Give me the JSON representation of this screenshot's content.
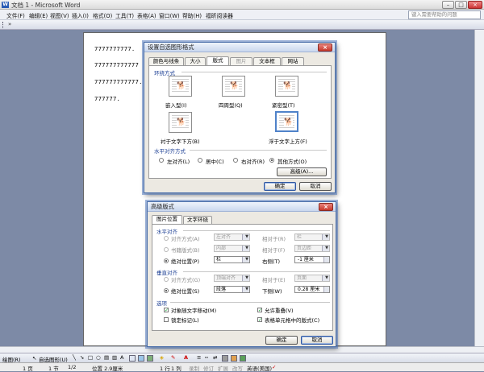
{
  "window": {
    "title": "文档 1 - Microsoft Word"
  },
  "menu": {
    "items": [
      "文件(F)",
      "编辑(E)",
      "视图(V)",
      "插入(I)",
      "格式(O)",
      "工具(T)",
      "表格(A)",
      "窗口(W)",
      "帮助(H)",
      "福昕阅读器"
    ],
    "help_placeholder": "键入需要帮助的问题"
  },
  "document": {
    "lines": [
      "7777777777.",
      "777777777777",
      "777777777777.",
      "777777."
    ]
  },
  "dialog1": {
    "title": "设置自选图形格式",
    "tabs": [
      "颜色与线条",
      "大小",
      "版式",
      "图片",
      "文本框",
      "网站"
    ],
    "section_wrap": "环绕方式",
    "wrap_options": [
      "嵌入型(I)",
      "四周型(Q)",
      "紧密型(T)",
      "衬于文字下方(B)",
      "浮于文字上方(F)"
    ],
    "section_halign": "水平对齐方式",
    "halign_options": [
      "左对齐(L)",
      "居中(C)",
      "右对齐(R)",
      "其他方式(O)"
    ],
    "advanced_label": "高级(A)...",
    "ok_label": "确定",
    "cancel_label": "取消"
  },
  "dialog2": {
    "title": "高级版式",
    "tabs": [
      "图片位置",
      "文字环绕"
    ],
    "section_h": "水平对齐",
    "h_rows": [
      {
        "label": "对齐方式(A)",
        "value": "左对齐",
        "rel_label": "相对于(R)",
        "rel_value": "栏"
      },
      {
        "label": "书籍版式(B)",
        "value": "内部",
        "rel_label": "相对于(F)",
        "rel_value": "页边距"
      },
      {
        "label": "绝对位置(P)",
        "value": "栏",
        "rel_label": "右侧(T)",
        "rel_value": "-1 厘米"
      }
    ],
    "section_v": "垂直对齐",
    "v_rows": [
      {
        "label": "对齐方式(G)",
        "value": "顶端对齐",
        "rel_label": "相对于(E)",
        "rel_value": "页面"
      },
      {
        "label": "绝对位置(S)",
        "value": "段落",
        "rel_label": "下侧(W)",
        "rel_value": "0.28 厘米"
      }
    ],
    "section_opts": "选项",
    "opts": [
      "对象随文字移动(M)",
      "锁定标记(L)",
      "允许重叠(V)",
      "表格单元格中的版式(C)"
    ],
    "ok_label": "确定",
    "cancel_label": "取消"
  },
  "drawbar": {
    "draw_label": "绘图(R)",
    "autoshape_label": "自选图形(U)"
  },
  "status": {
    "page": "1 页",
    "section": "1 节",
    "pages": "1/2",
    "position": "位置 2.9厘米",
    "line": "1 行",
    "col": "1 列",
    "rec": "录制",
    "rev": "修订",
    "ext": "扩展",
    "ovr": "改写",
    "lang": "英语(美国)"
  },
  "colors": {
    "accent": "#4a6ea9",
    "close_red": "#c8382c"
  }
}
